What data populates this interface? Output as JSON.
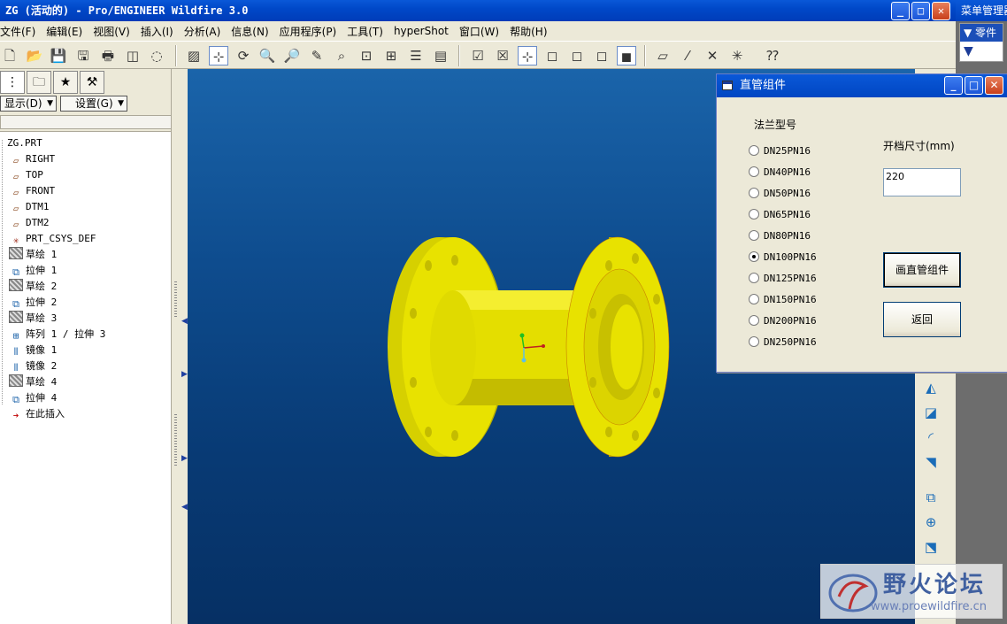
{
  "window": {
    "title": "ZG (活动的) - Pro/ENGINEER Wildfire 3.0",
    "buttons": {
      "minimize": "_",
      "maximize": "□",
      "close": "✕"
    }
  },
  "menu_manager": {
    "title": "菜单管理器",
    "item": "▼ 零件",
    "arrow": "▼"
  },
  "menubar": [
    "文件(F)",
    "编辑(E)",
    "视图(V)",
    "插入(I)",
    "分析(A)",
    "信息(N)",
    "应用程序(P)",
    "工具(T)",
    "hyperShot",
    "窗口(W)",
    "帮助(H)"
  ],
  "toolbar_icons": [
    "new-file-icon",
    "open-file-icon",
    "save-icon",
    "save-copy-icon",
    "print-icon",
    "close-window-icon",
    "erase-icon",
    "repaint-icon",
    "spin-center-icon",
    "orient-mode-icon",
    "zoom-in-icon",
    "zoom-out-icon",
    "refit-icon",
    "view-manager-icon",
    "saved-views-icon",
    "named-view-icon",
    "layers-icon",
    "appearance-icon",
    "regenerate-icon",
    "close-icon",
    "csys-display-icon",
    "wireframe-icon",
    "hidden-line-icon",
    "no-hidden-icon",
    "shading-icon",
    "datum-planes-icon",
    "datum-axes-icon",
    "datum-points-icon",
    "csys-toggle-icon",
    "context-help-icon"
  ],
  "navigator": {
    "tabs": [
      "model-tree-tab",
      "folder-tab",
      "favorites-tab",
      "connections-tab"
    ],
    "show_label": "显示(D)",
    "settings_label": "设置(G)",
    "tree": [
      {
        "label": "ZG.PRT",
        "icon": "part"
      },
      {
        "label": "RIGHT",
        "icon": "plane"
      },
      {
        "label": "TOP",
        "icon": "plane"
      },
      {
        "label": "FRONT",
        "icon": "plane"
      },
      {
        "label": "DTM1",
        "icon": "plane"
      },
      {
        "label": "DTM2",
        "icon": "plane"
      },
      {
        "label": "PRT_CSYS_DEF",
        "icon": "csys"
      },
      {
        "label": "草绘 1",
        "icon": "sketch"
      },
      {
        "label": "拉伸 1",
        "icon": "extrude"
      },
      {
        "label": "草绘 2",
        "icon": "sketch"
      },
      {
        "label": "拉伸 2",
        "icon": "extrude"
      },
      {
        "label": "草绘 3",
        "icon": "sketch"
      },
      {
        "label": "阵列 1 / 拉伸 3",
        "icon": "pattern"
      },
      {
        "label": "镜像 1",
        "icon": "mirror"
      },
      {
        "label": "镜像 2",
        "icon": "mirror"
      },
      {
        "label": "草绘 4",
        "icon": "sketch"
      },
      {
        "label": "拉伸 4",
        "icon": "extrude"
      },
      {
        "label": "在此插入",
        "icon": "insert"
      }
    ]
  },
  "dialog": {
    "title": "直管组件",
    "flange_label": "法兰型号",
    "size_label": "开档尺寸(mm)",
    "size_value": "220",
    "options": [
      "DN25PN16",
      "DN40PN16",
      "DN50PN16",
      "DN65PN16",
      "DN80PN16",
      "DN100PN16",
      "DN125PN16",
      "DN150PN16",
      "DN200PN16",
      "DN250PN16"
    ],
    "selected_index": 5,
    "draw_button": "画直管组件",
    "back_button": "返回"
  },
  "watermark": {
    "text": "野火论坛",
    "url": "www.proewildfire.cn"
  },
  "colors": {
    "part": "#e8e000",
    "part_dark": "#b8b000",
    "background_top": "#1a64aa",
    "background_bottom": "#063064"
  }
}
